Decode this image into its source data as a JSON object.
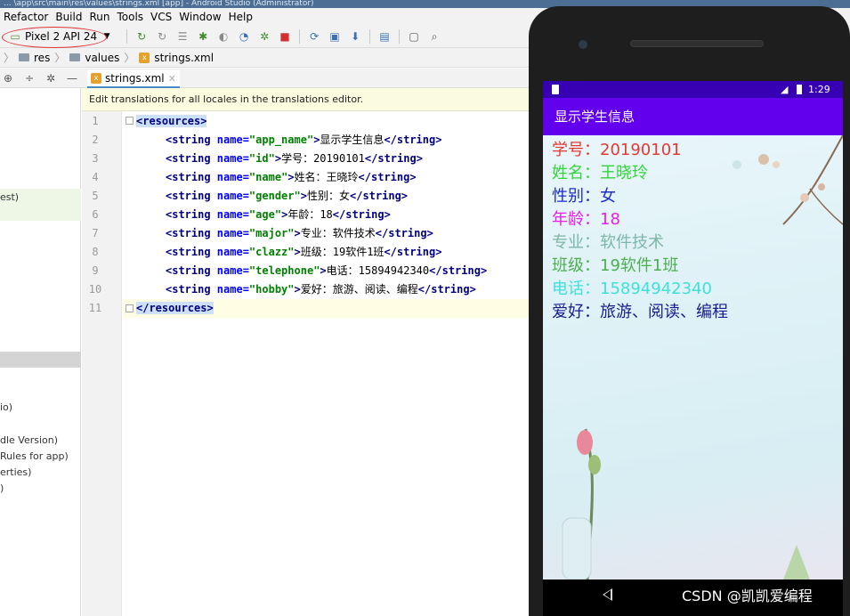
{
  "ide": {
    "title_fragment": "... \\app\\src\\main\\res\\values\\strings.xml [app] - Android Studio (Administrator)",
    "menu": [
      "Refactor",
      "Build",
      "Run",
      "Tools",
      "VCS",
      "Window",
      "Help"
    ],
    "device_selector": "Pixel 2 API 24",
    "breadcrumbs": [
      "res",
      "values",
      "strings.xml"
    ],
    "editor_tab": "strings.xml",
    "notice": "Edit translations for all locales in the translations editor.",
    "left_panel_fragments": [
      "est)",
      "io)",
      "dle Version)",
      "Rules for app)",
      "erties)",
      ")"
    ],
    "line_numbers": [
      "1",
      "2",
      "3",
      "4",
      "5",
      "6",
      "7",
      "8",
      "9",
      "10",
      "11"
    ],
    "code": {
      "open_tag": "<resources>",
      "close_tag": "</resources>",
      "strings": [
        {
          "name": "app_name",
          "value": "显示学生信息"
        },
        {
          "name": "id",
          "value": "学号：20190101"
        },
        {
          "name": "name",
          "value": "姓名：王晓玲"
        },
        {
          "name": "gender",
          "value": "性别：女"
        },
        {
          "name": "age",
          "value": "年龄：18"
        },
        {
          "name": "major",
          "value": "专业：软件技术"
        },
        {
          "name": "clazz",
          "value": "班级：19软件1班"
        },
        {
          "name": "telephone",
          "value": "电话：15894942340"
        },
        {
          "name": "hobby",
          "value": "爱好：旅游、阅读、编程"
        }
      ]
    }
  },
  "emulator": {
    "status_time": "1:29",
    "app_title": "显示学生信息",
    "fields": [
      {
        "text": "学号：20190101",
        "color": "#e53935"
      },
      {
        "text": "姓名：王晓玲",
        "color": "#32d43a"
      },
      {
        "text": "性别：女",
        "color": "#1c2ccf"
      },
      {
        "text": "年龄：18",
        "color": "#e91ee9"
      },
      {
        "text": "专业：软件技术",
        "color": "#7cb7a4"
      },
      {
        "text": "班级：19软件1班",
        "color": "#4caf50"
      },
      {
        "text": "电话：15894942340",
        "color": "#3ee0d8"
      },
      {
        "text": "爱好：旅游、阅读、编程",
        "color": "#1a1a8f"
      }
    ]
  },
  "watermark": "CSDN @凯凯爱编程"
}
